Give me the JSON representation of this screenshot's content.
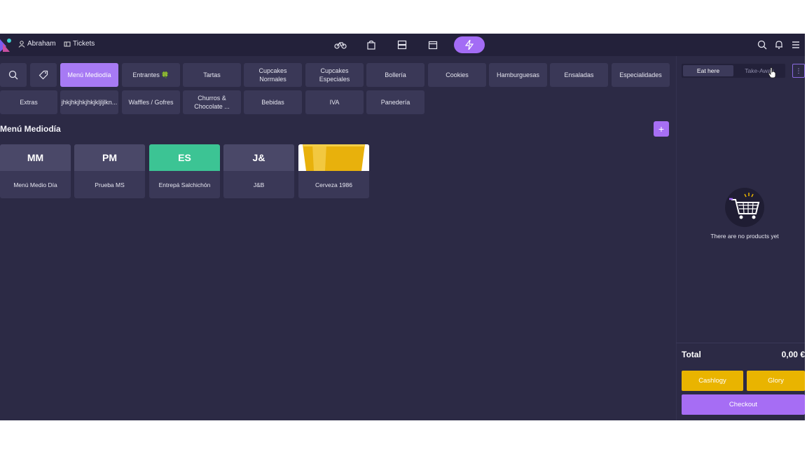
{
  "topbar": {
    "user": "Abraham",
    "tickets": "Tickets",
    "center_icons": [
      "bike-icon",
      "bag-icon",
      "server-icon",
      "calendar-icon",
      "lightning-icon"
    ],
    "right_icons": [
      "search-icon",
      "bell-icon",
      "menu-icon"
    ]
  },
  "categories": {
    "row1": [
      "Menú Mediodía",
      "Entrantes 🍀",
      "Tartas",
      "Cupcakes Normales",
      "Cupcakes Especiales",
      "Bollería",
      "Cookies",
      "Hamburguesas",
      "Ensaladas",
      "Especialidades"
    ],
    "row2": [
      "Extras",
      "jhkjhkjhkjhkjkljljlkn...",
      "Waffles / Gofres",
      "Churros & Chocolate ...",
      "Bebidas",
      "IVA",
      "Panedería"
    ],
    "active": "Menú Mediodía"
  },
  "section": {
    "title": "Menú Mediodía",
    "add": "+"
  },
  "products": [
    {
      "abbr": "MM",
      "name": "Menú Medio Día",
      "color": "#4a4868"
    },
    {
      "abbr": "PM",
      "name": "Prueba MS",
      "color": "#4a4868"
    },
    {
      "abbr": "ES",
      "name": "Entrepá Salchichón",
      "color": "#3cc494"
    },
    {
      "abbr": "J&",
      "name": "J&B",
      "color": "#4a4868"
    },
    {
      "abbr": "",
      "name": "Cerveza 1986",
      "color": "#e8b10c"
    }
  ],
  "order": {
    "eat_here": "Eat here",
    "take_away": "Take-Away",
    "more": "⋮",
    "empty": "There are no products yet",
    "total_label": "Total",
    "total_value": "0,00 €",
    "cashlogy": "Cashlogy",
    "glory": "Glory",
    "checkout": "Checkout"
  },
  "colors": {
    "accent": "#a36cf5",
    "pay": "#e9b400",
    "background": "#2c2a45"
  }
}
